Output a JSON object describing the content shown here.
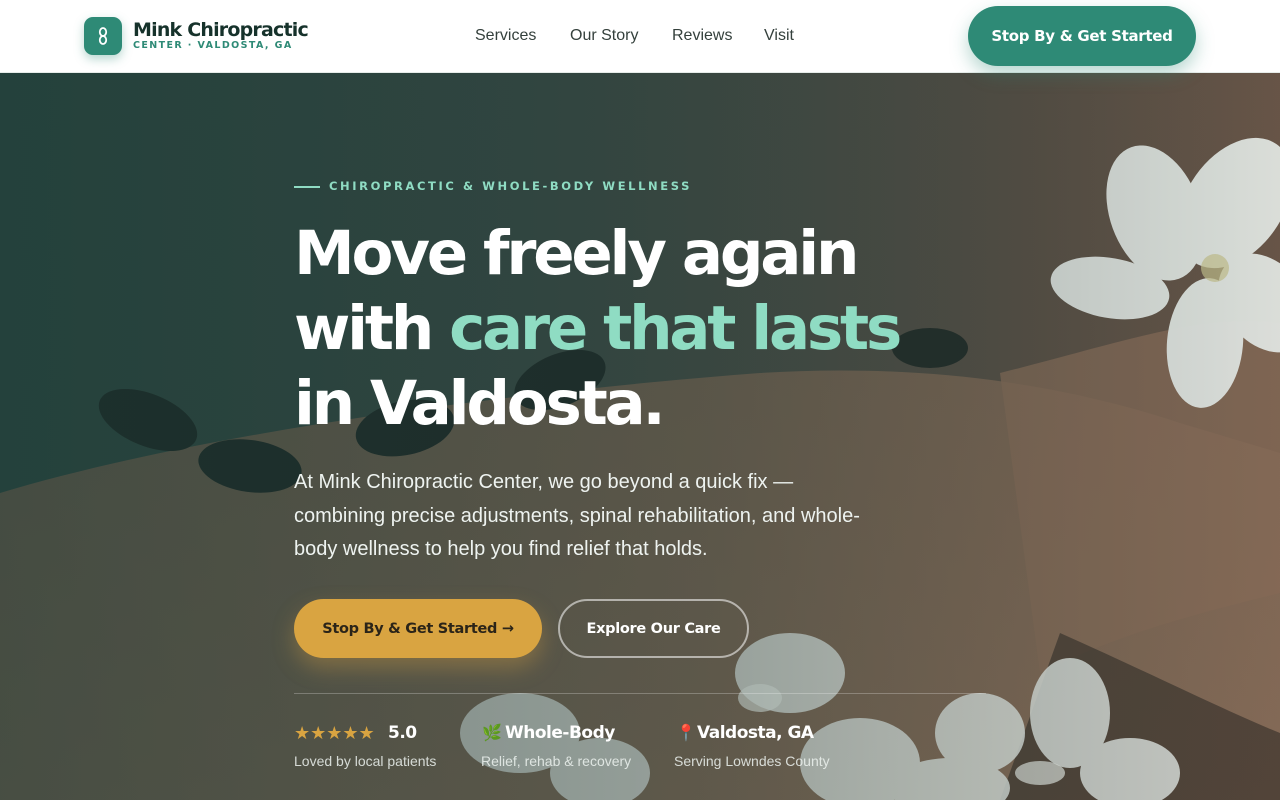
{
  "brand": {
    "name": "Mink Chiropractic",
    "tagline": "CENTER · VALDOSTA, GA",
    "icon": "spine-icon",
    "color": "#2e8a76"
  },
  "nav": {
    "items": [
      {
        "label": "Services"
      },
      {
        "label": "Our Story"
      },
      {
        "label": "Reviews"
      },
      {
        "label": "Visit"
      }
    ],
    "cta_label": "Stop By & Get Started"
  },
  "hero": {
    "eyebrow": "CHIROPRACTIC & WHOLE-BODY WELLNESS",
    "headline": {
      "line1": "Move freely again",
      "line2_prefix": "with ",
      "line2_accent": "care that lasts",
      "line3": "in Valdosta."
    },
    "lede": "At Mink Chiropractic Center, we go beyond a quick fix — combining precise adjustments, spinal rehabilitation, and whole-body wellness to help you find relief that holds.",
    "primary_cta": "Stop By & Get Started →",
    "secondary_cta": "Explore Our Care",
    "accent_color": "#8fdcc3",
    "cta_color": "#d9a441"
  },
  "stats": [
    {
      "icon": "star-icon",
      "stars": "★★★★★",
      "value": "5.0",
      "label": "Loved by local patients"
    },
    {
      "icon": "leaf-icon",
      "glyph": "🌿",
      "value": "Whole-Body",
      "label": "Relief, rehab & recovery"
    },
    {
      "icon": "map-pin-icon",
      "glyph": "📍",
      "value": "Valdosta, GA",
      "label": "Serving Lowndes County"
    }
  ]
}
